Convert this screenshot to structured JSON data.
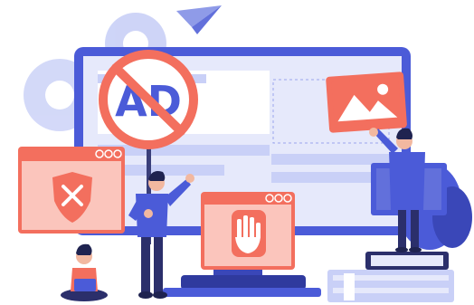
{
  "ad_sign": {
    "text": "AD"
  },
  "colors": {
    "primary_blue": "#4B5BD8",
    "light_blue": "#C9D0F7",
    "pale_blue": "#E6E9FB",
    "salmon": "#F36F5E",
    "salmon_light": "#FBC5BC",
    "navy": "#2B2F6B",
    "skin": "#F2B8A0",
    "hair": "#1F2350"
  },
  "icons": [
    "shield-x-icon",
    "hand-stop-icon",
    "image-icon",
    "play-icon",
    "paper-plane-icon",
    "gear-icon",
    "no-ad-sign-icon"
  ]
}
